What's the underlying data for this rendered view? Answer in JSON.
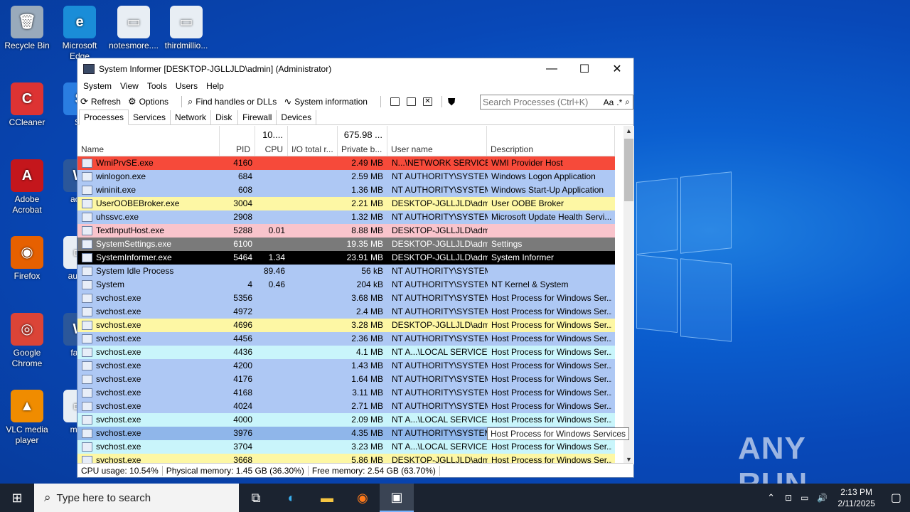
{
  "desktop": {
    "icons": [
      {
        "label": "Recycle Bin",
        "color": "#9ab",
        "glyph": "🗑"
      },
      {
        "label": "Microsoft Edge",
        "color": "#1a8dd8",
        "glyph": "e"
      },
      {
        "label": "notesmore....",
        "color": "#e8eef4",
        "glyph": "▭"
      },
      {
        "label": "thirdmillio...",
        "color": "#e8eef4",
        "glyph": "▭"
      },
      {
        "label": "CCleaner",
        "color": "#d33",
        "glyph": "C"
      },
      {
        "label": "Sk",
        "color": "#2a7de1",
        "glyph": "S"
      },
      {
        "label": "Adobe Acrobat",
        "color": "#c4161c",
        "glyph": "A"
      },
      {
        "label": "acad",
        "color": "#2b579a",
        "glyph": "W"
      },
      {
        "label": "Firefox",
        "color": "#e66000",
        "glyph": "◉"
      },
      {
        "label": "augus",
        "color": "#e8eef4",
        "glyph": "▭"
      },
      {
        "label": "Google Chrome",
        "color": "#db4437",
        "glyph": "◎"
      },
      {
        "label": "famil",
        "color": "#2b579a",
        "glyph": "W"
      },
      {
        "label": "VLC media player",
        "color": "#f08c00",
        "glyph": "▲"
      },
      {
        "label": "moth",
        "color": "#e8eef4",
        "glyph": "▭"
      }
    ],
    "watermark": "ANY RUN"
  },
  "window": {
    "title": "System Informer [DESKTOP-JGLLJLD\\admin] (Administrator)",
    "minimize": "—",
    "maximize": "☐",
    "close": "✕",
    "menu": [
      "System",
      "View",
      "Tools",
      "Users",
      "Help"
    ],
    "toolbar": {
      "refresh": "Refresh",
      "options": "Options",
      "find": "Find handles or DLLs",
      "sysinfo": "System information",
      "search_placeholder": "Search Processes (Ctrl+K)",
      "aa": "Aa",
      "regex": ".*"
    },
    "tabs": [
      "Processes",
      "Services",
      "Network",
      "Disk",
      "Firewall",
      "Devices"
    ],
    "columns": {
      "name": "Name",
      "pid": "PID",
      "cpu": "CPU",
      "cpu_total": "10....",
      "io": "I/O total r...",
      "priv": "Private b...",
      "priv_total": "675.98 ...",
      "user": "User name",
      "desc": "Description"
    },
    "processes": [
      {
        "name": "WmiPrvSE.exe",
        "pid": "4160",
        "cpu": "",
        "priv": "2.49 MB",
        "user": "N...\\NETWORK SERVICE",
        "desc": "WMI Provider Host",
        "bg": "#f64a3a",
        "fg": "#000"
      },
      {
        "name": "winlogon.exe",
        "pid": "684",
        "cpu": "",
        "priv": "2.59 MB",
        "user": "NT AUTHORITY\\SYSTEM",
        "desc": "Windows Logon Application",
        "bg": "#aec8f4",
        "fg": "#000"
      },
      {
        "name": "wininit.exe",
        "pid": "608",
        "cpu": "",
        "priv": "1.36 MB",
        "user": "NT AUTHORITY\\SYSTEM",
        "desc": "Windows Start-Up Application",
        "bg": "#aec8f4",
        "fg": "#000"
      },
      {
        "name": "UserOOBEBroker.exe",
        "pid": "3004",
        "cpu": "",
        "priv": "2.21 MB",
        "user": "DESKTOP-JGLLJLD\\admi",
        "desc": "User OOBE Broker",
        "bg": "#fdf7a4",
        "fg": "#000"
      },
      {
        "name": "uhssvc.exe",
        "pid": "2908",
        "cpu": "",
        "priv": "1.32 MB",
        "user": "NT AUTHORITY\\SYSTEM",
        "desc": "Microsoft Update Health Servi...",
        "bg": "#aec8f4",
        "fg": "#000"
      },
      {
        "name": "TextInputHost.exe",
        "pid": "5288",
        "cpu": "0.01",
        "priv": "8.88 MB",
        "user": "DESKTOP-JGLLJLD\\admi",
        "desc": "",
        "bg": "#f9c4cc",
        "fg": "#000"
      },
      {
        "name": "SystemSettings.exe",
        "pid": "6100",
        "cpu": "",
        "priv": "19.35 MB",
        "user": "DESKTOP-JGLLJLD\\admi",
        "desc": "Settings",
        "bg": "#7a7a7a",
        "fg": "#fff"
      },
      {
        "name": "SystemInformer.exe",
        "pid": "5464",
        "cpu": "1.34",
        "priv": "23.91 MB",
        "user": "DESKTOP-JGLLJLD\\admi",
        "desc": "System Informer",
        "bg": "#000",
        "fg": "#fff"
      },
      {
        "name": "System Idle Process",
        "pid": "",
        "cpu": "89.46",
        "priv": "56 kB",
        "user": "NT AUTHORITY\\SYSTEM",
        "desc": "",
        "bg": "#aec8f4",
        "fg": "#000"
      },
      {
        "name": "System",
        "pid": "4",
        "cpu": "0.46",
        "priv": "204 kB",
        "user": "NT AUTHORITY\\SYSTEM",
        "desc": "NT Kernel & System",
        "bg": "#aec8f4",
        "fg": "#000"
      },
      {
        "name": "svchost.exe",
        "pid": "5356",
        "cpu": "",
        "priv": "3.68 MB",
        "user": "NT AUTHORITY\\SYSTEM",
        "desc": "Host Process for Windows Ser...",
        "bg": "#aec8f4",
        "fg": "#000"
      },
      {
        "name": "svchost.exe",
        "pid": "4972",
        "cpu": "",
        "priv": "2.4 MB",
        "user": "NT AUTHORITY\\SYSTEM",
        "desc": "Host Process for Windows Ser...",
        "bg": "#aec8f4",
        "fg": "#000"
      },
      {
        "name": "svchost.exe",
        "pid": "4696",
        "cpu": "",
        "priv": "3.28 MB",
        "user": "DESKTOP-JGLLJLD\\admi",
        "desc": "Host Process for Windows Ser...",
        "bg": "#fdf7a4",
        "fg": "#000"
      },
      {
        "name": "svchost.exe",
        "pid": "4456",
        "cpu": "",
        "priv": "2.36 MB",
        "user": "NT AUTHORITY\\SYSTEM",
        "desc": "Host Process for Windows Ser...",
        "bg": "#aec8f4",
        "fg": "#000"
      },
      {
        "name": "svchost.exe",
        "pid": "4436",
        "cpu": "",
        "priv": "4.1 MB",
        "user": "NT A...\\LOCAL SERVICE",
        "desc": "Host Process for Windows Ser...",
        "bg": "#c9f5fb",
        "fg": "#000"
      },
      {
        "name": "svchost.exe",
        "pid": "4200",
        "cpu": "",
        "priv": "1.43 MB",
        "user": "NT AUTHORITY\\SYSTEM",
        "desc": "Host Process for Windows Ser...",
        "bg": "#aec8f4",
        "fg": "#000"
      },
      {
        "name": "svchost.exe",
        "pid": "4176",
        "cpu": "",
        "priv": "1.64 MB",
        "user": "NT AUTHORITY\\SYSTEM",
        "desc": "Host Process for Windows Ser...",
        "bg": "#aec8f4",
        "fg": "#000"
      },
      {
        "name": "svchost.exe",
        "pid": "4168",
        "cpu": "",
        "priv": "3.11 MB",
        "user": "NT AUTHORITY\\SYSTEM",
        "desc": "Host Process for Windows Ser...",
        "bg": "#aec8f4",
        "fg": "#000"
      },
      {
        "name": "svchost.exe",
        "pid": "4024",
        "cpu": "",
        "priv": "2.71 MB",
        "user": "NT AUTHORITY\\SYSTEM",
        "desc": "Host Process for Windows Ser...",
        "bg": "#aec8f4",
        "fg": "#000"
      },
      {
        "name": "svchost.exe",
        "pid": "4000",
        "cpu": "",
        "priv": "2.09 MB",
        "user": "NT A...\\LOCAL SERVICE",
        "desc": "Host Process for Windows Ser...",
        "bg": "#c9f5fb",
        "fg": "#000"
      },
      {
        "name": "svchost.exe",
        "pid": "3976",
        "cpu": "",
        "priv": "4.35 MB",
        "user": "NT AUTHORITY\\SYSTEM",
        "desc": "Host Process for Windows Services",
        "bg": "#8fb6ea",
        "fg": "#000"
      },
      {
        "name": "svchost.exe",
        "pid": "3704",
        "cpu": "",
        "priv": "3.23 MB",
        "user": "NT A...\\LOCAL SERVICE",
        "desc": "Host Process for Windows Ser...",
        "bg": "#c9f5fb",
        "fg": "#000"
      },
      {
        "name": "svchost.exe",
        "pid": "3668",
        "cpu": "",
        "priv": "5.86 MB",
        "user": "DESKTOP-JGLLJLD\\admi",
        "desc": "Host Process for Windows Ser...",
        "bg": "#fdf7a4",
        "fg": "#000"
      }
    ],
    "tooltip": "Host Process for Windows Services",
    "status": {
      "cpu": "CPU usage: 10.54%",
      "phys": "Physical memory: 1.45 GB (36.30%)",
      "free": "Free memory: 2.54 GB (63.70%)"
    }
  },
  "taskbar": {
    "search_placeholder": "Type here to search",
    "time": "2:13 PM",
    "date": "2/11/2025"
  }
}
